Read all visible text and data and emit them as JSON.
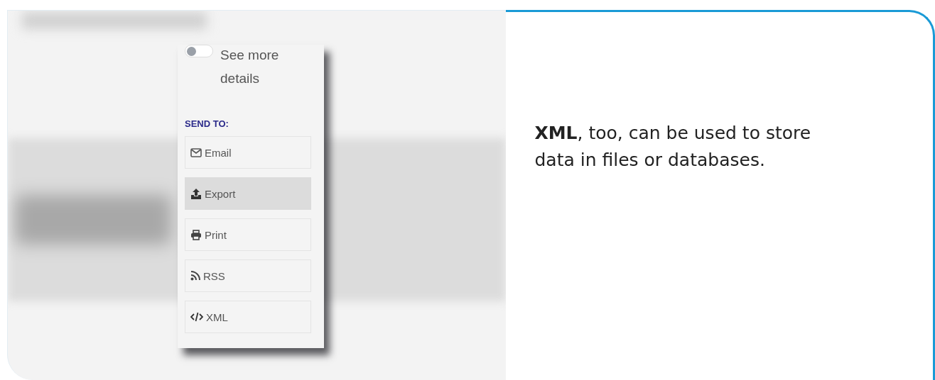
{
  "toggle": {
    "label": "See more details",
    "on": false
  },
  "send_to": {
    "heading": "SEND TO:",
    "buttons": [
      {
        "label": "Email",
        "kind": "email",
        "selected": false
      },
      {
        "label": "Export",
        "kind": "export",
        "selected": true
      },
      {
        "label": "Print",
        "kind": "print",
        "selected": false
      },
      {
        "label": "RSS",
        "kind": "rss",
        "selected": false
      },
      {
        "label": "XML",
        "kind": "xml",
        "selected": false
      }
    ]
  },
  "caption": "**XML**, too, can be used to store data in files or databases."
}
